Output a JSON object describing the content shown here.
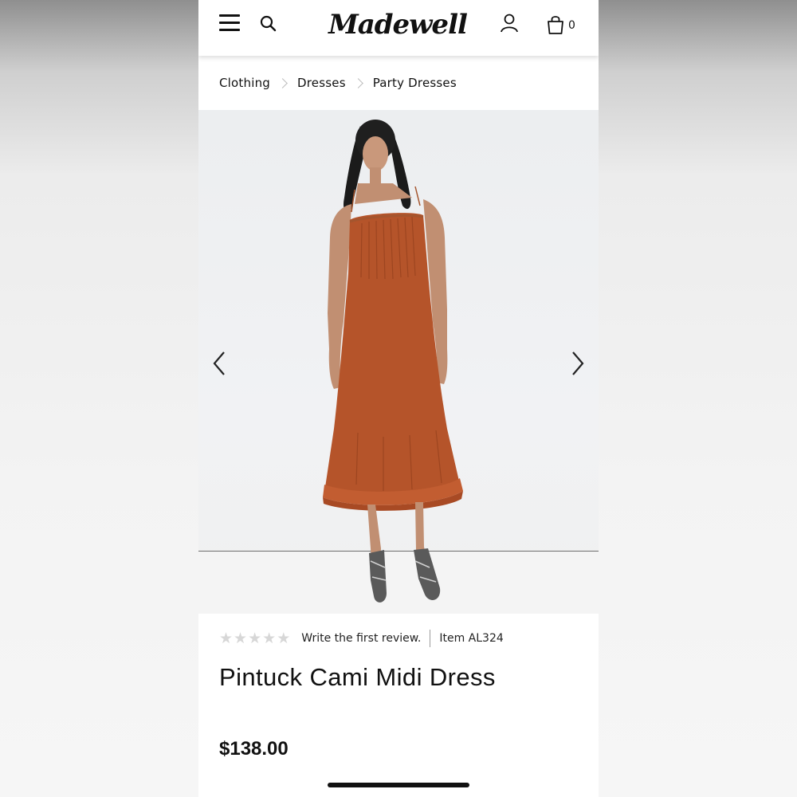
{
  "brand": {
    "logo_text": "Madewell"
  },
  "header": {
    "bag_count": "0",
    "icons": [
      "menu-icon",
      "search-icon",
      "account-icon",
      "bag-icon"
    ]
  },
  "breadcrumb": [
    {
      "label": "Clothing"
    },
    {
      "label": "Dresses"
    },
    {
      "label": "Party Dresses"
    }
  ],
  "hero": {
    "image": "product-photo",
    "prev_icon": "chevron-left-icon",
    "next_icon": "chevron-right-icon",
    "dress_color": "#b5542a"
  },
  "product": {
    "rating_stars": 0,
    "rating_max": 5,
    "review_link": "Write the first review.",
    "item_number": "Item AL324",
    "title": "Pintuck Cami Midi Dress",
    "price": "$138.00"
  }
}
